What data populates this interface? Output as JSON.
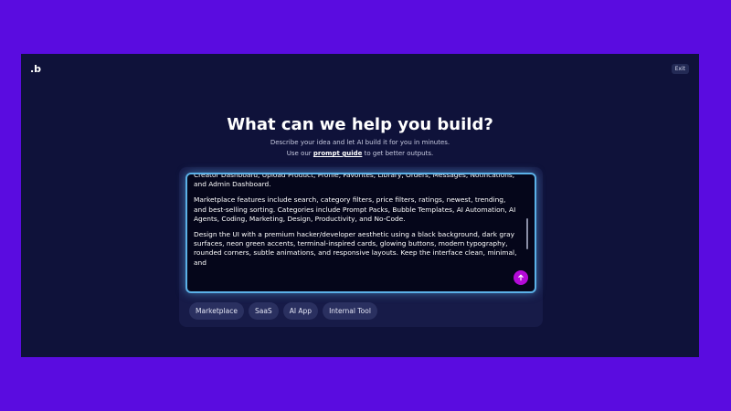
{
  "app": {
    "logo": ".b",
    "exit_label": "Exit"
  },
  "hero": {
    "title": "What can we help you build?",
    "subtitle": "Describe your idea and let AI build it for you in minutes.",
    "guide_prefix": "Use our ",
    "guide_link": "prompt guide",
    "guide_suffix": " to get better outputs."
  },
  "composer": {
    "paragraphs": [
      "Creator Dashboard, Upload Product, Profile, Favorites, Library, Orders, Messages, Notifications, and Admin Dashboard.",
      "Marketplace features include search, category filters, price filters, ratings, newest, trending, and best-selling sorting. Categories include Prompt Packs, Bubble Templates, AI Automation, AI Agents, Coding, Marketing, Design, Productivity, and No-Code.",
      "Design the UI with a premium hacker/developer aesthetic using a black background, dark gray surfaces, neon green accents, terminal-inspired cards, glowing buttons, modern typography, rounded corners, subtle animations, and responsive layouts. Keep the interface clean, minimal, and"
    ],
    "send_icon": "arrow-up-icon"
  },
  "chips": [
    "Marketplace",
    "SaaS",
    "AI App",
    "Internal Tool"
  ],
  "colors": {
    "page_bg": "#5a0ce0",
    "window_bg": "#0f123a",
    "accent_border": "#5bb1e8",
    "send_button": "#b40ad8",
    "chip_bg": "#2a3060"
  }
}
